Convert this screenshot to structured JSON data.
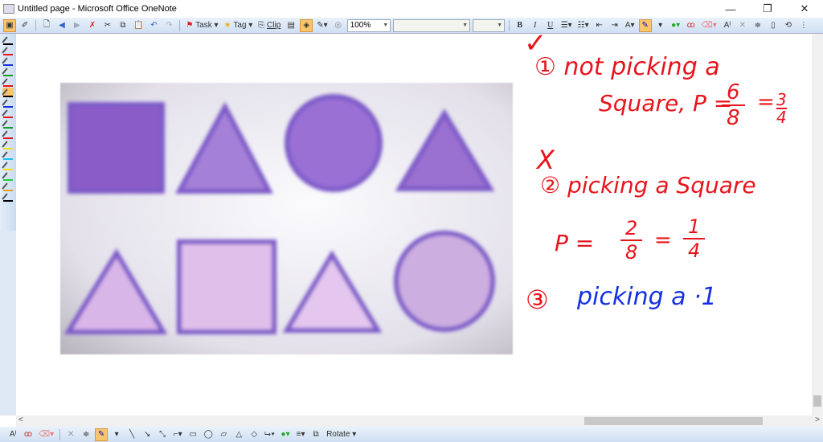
{
  "window": {
    "title": "Untitled page - Microsoft Office OneNote",
    "minimize": "—",
    "restore": "❐",
    "close": "✕"
  },
  "toolbar": {
    "task_label": "Task",
    "tag_label": "Tag",
    "clip_label": "Clip",
    "zoom_value": "100%",
    "font_value": "",
    "size_value": "",
    "bold": "B",
    "italic": "I",
    "underline": "U"
  },
  "drawing_toolbar": {
    "rotate_label": "Rotate"
  },
  "pen_colors": [
    "#000000",
    "#e8141c",
    "#1430e0",
    "#1a9a2a",
    "#e8141c",
    "#000000",
    "#1430e0",
    "#e8141c",
    "#1a9a2a",
    "#e8141c",
    "#f0e020",
    "#20c0f0",
    "#f0e020",
    "#20d040",
    "#e0a020",
    "#000000"
  ],
  "notes": {
    "check": "✓",
    "line1": "① not picking a",
    "line2": "Square, P =",
    "frac1_num": "6",
    "frac1_den": "8",
    "eq1": "=",
    "frac1b_num": "3",
    "frac1b_den": "4",
    "cross": "X",
    "line3": "② picking a Square",
    "line4": "P =",
    "frac2_num": "2",
    "frac2_den": "8",
    "eq2": "=",
    "frac2b_num": "1",
    "frac2b_den": "4",
    "line5_num": "③",
    "line5": "picking a ·1"
  },
  "colors": {
    "red_ink": "#e8141c",
    "blue_ink": "#1430e0",
    "shape_dark": "#8a5cc8",
    "shape_light": "#d9b6e8"
  }
}
